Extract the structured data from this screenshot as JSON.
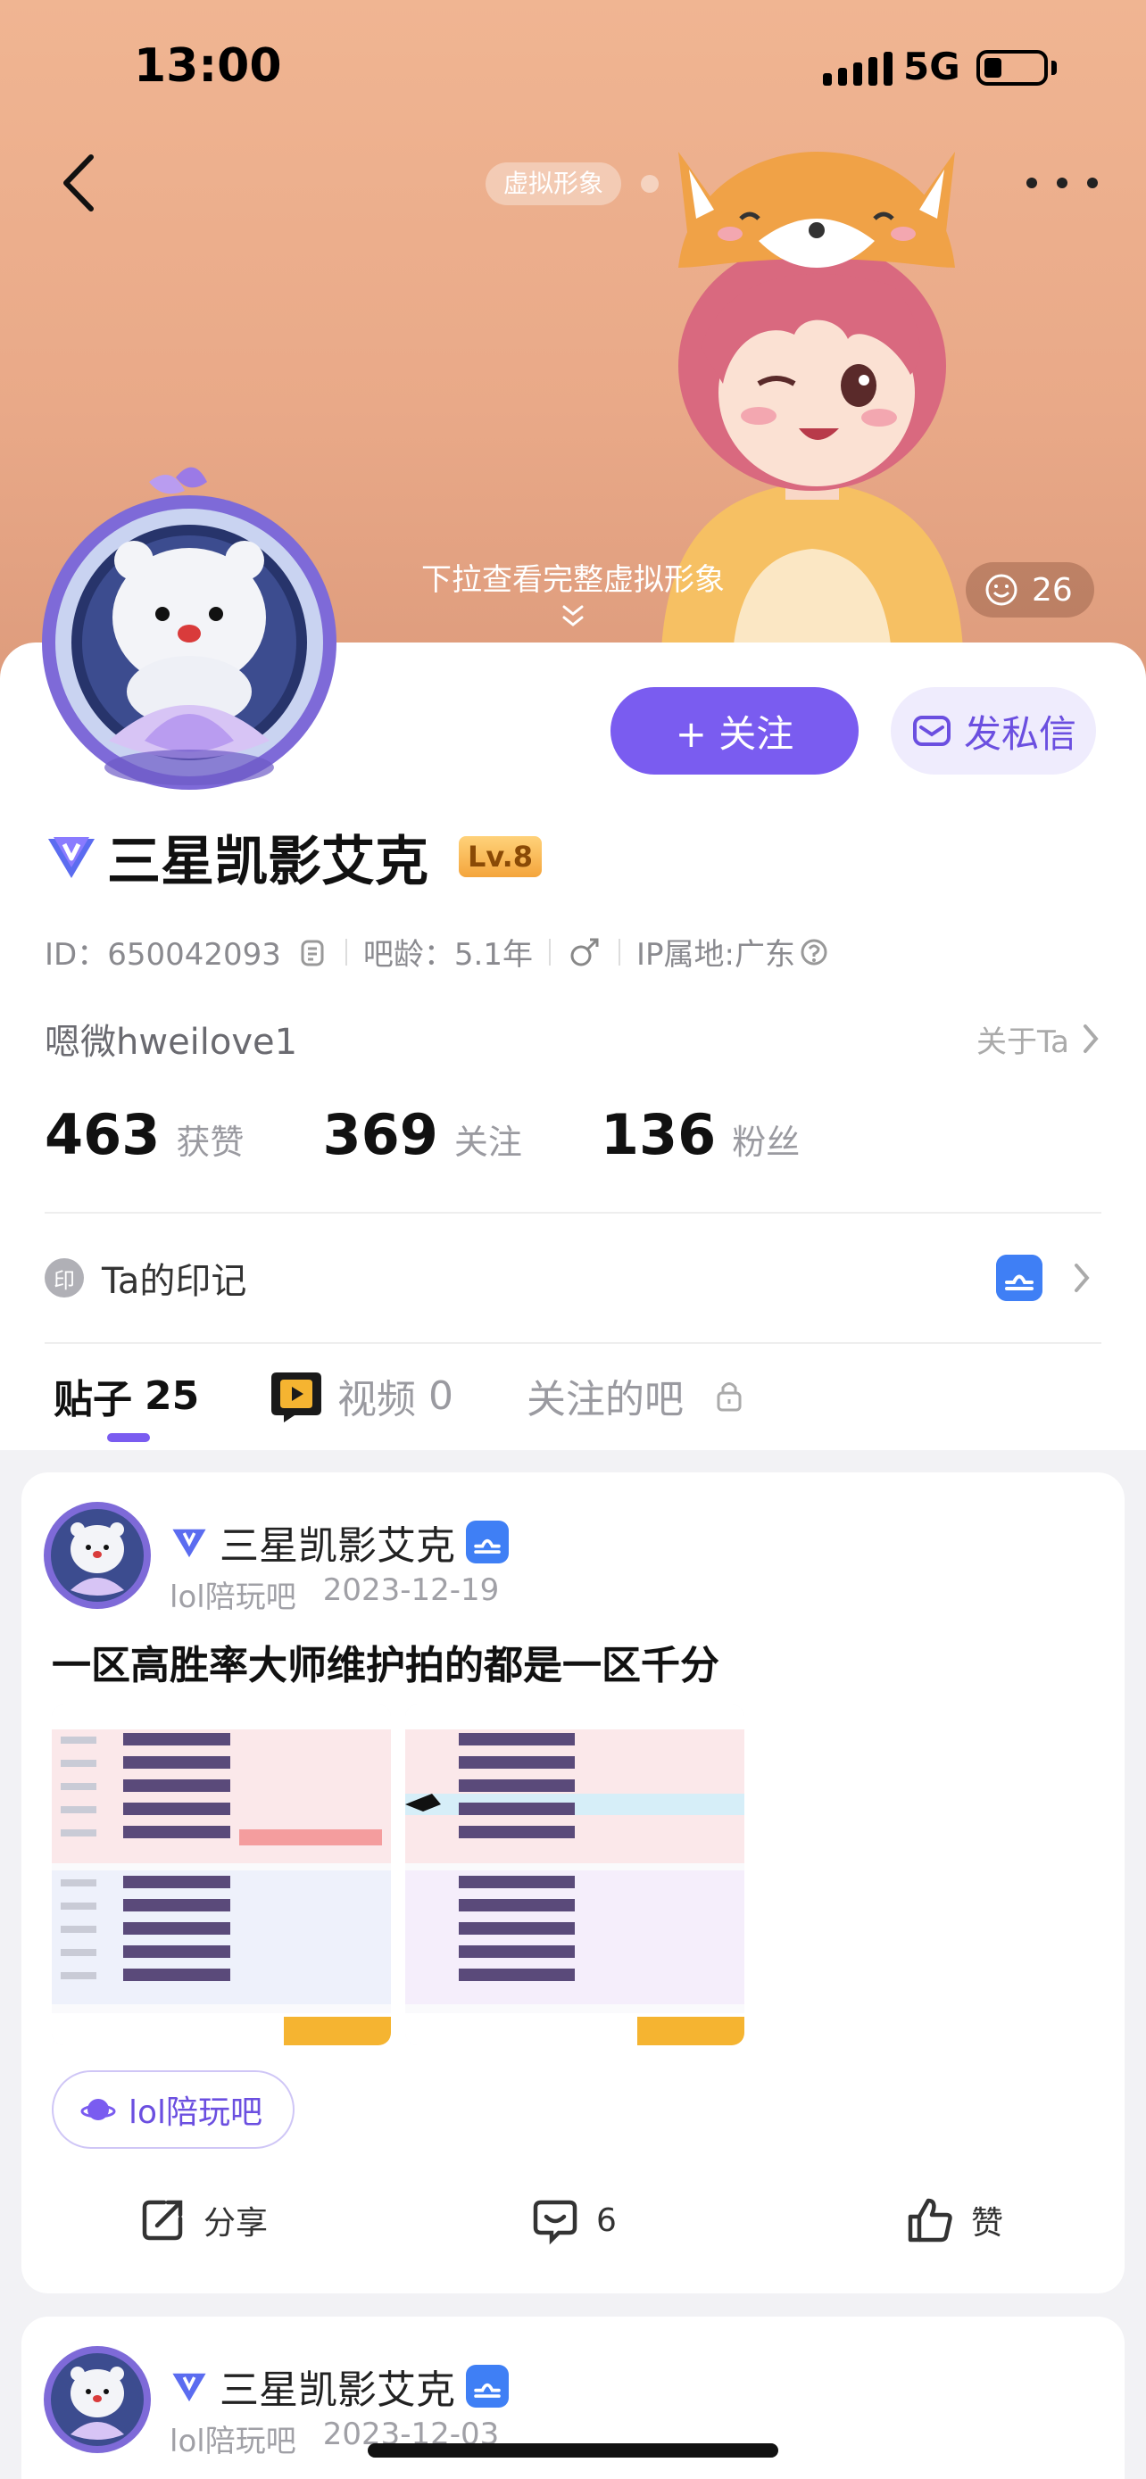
{
  "status_bar": {
    "time": "13:00",
    "network": "5G",
    "battery_level": 0.3
  },
  "header": {
    "avatar_tag": "虚拟形象",
    "pull_hint": "下拉查看完整虚拟形象",
    "like_count": "26",
    "icons": {
      "back": "chevron-left-icon",
      "more": "more-horizontal-icon"
    }
  },
  "profile": {
    "follow_label": "+ 关注",
    "message_label": "发私信",
    "name": "三星凯影艾克",
    "level": "Lv.8",
    "id_text": "ID：650042093",
    "bar_age": "吧龄：5.1年",
    "ip_location": "IP属地:广东",
    "signature": "嗯微hweilove1",
    "about_label": "关于Ta",
    "stats": [
      {
        "value": "463",
        "label": "获赞"
      },
      {
        "value": "369",
        "label": "关注"
      },
      {
        "value": "136",
        "label": "粉丝"
      }
    ],
    "mark_icon_text": "印",
    "mark_label": "Ta的印记"
  },
  "tabs": [
    {
      "label": "贴子",
      "count": "25"
    },
    {
      "label": "视频",
      "count": "0"
    },
    {
      "label": "关注的吧"
    }
  ],
  "posts": [
    {
      "author": "三星凯影艾克",
      "forum": "lol陪玩吧",
      "date": "2023-12-19",
      "title": "一区高胜率大师维护拍的都是一区千分",
      "forum_chip": "lol陪玩吧",
      "share_label": "分享",
      "comment_count": "6",
      "like_label": "赞"
    },
    {
      "author": "三星凯影艾克",
      "forum": "lol陪玩吧",
      "date": "2023-12-03"
    }
  ],
  "colors": {
    "accent": "#7a5cf0",
    "hero_bg": "#e9a988",
    "level_badge": "#f4a53c",
    "mark_badge": "#3f7ff5"
  }
}
